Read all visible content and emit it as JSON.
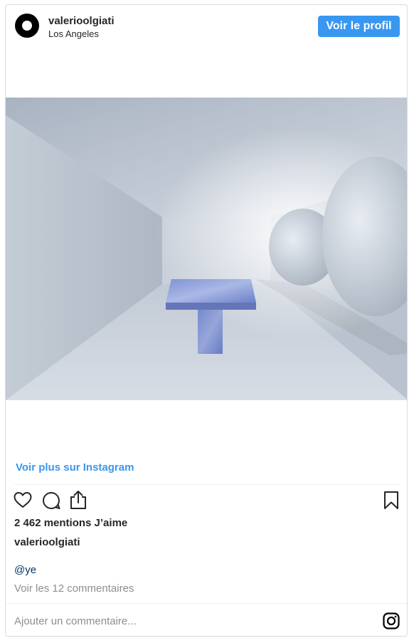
{
  "header": {
    "username": "valerioolgiati",
    "location": "Los Angeles",
    "profile_button": "Voir le profil"
  },
  "post": {
    "more_link": "Voir plus sur Instagram",
    "likes": "2 462 mentions J’aime",
    "caption_username": "valerioolgiati",
    "mention": "@ye",
    "comments_link": "Voir les 12 commentaires",
    "comment_placeholder": "Ajouter un commentaire..."
  },
  "icons": {
    "like": "heart-icon",
    "comment": "comment-bubble-icon",
    "share": "share-icon",
    "save": "bookmark-icon",
    "brand": "instagram-icon"
  },
  "colors": {
    "accent": "#3897f0",
    "mention": "#003569",
    "muted": "#8e8e8e"
  }
}
